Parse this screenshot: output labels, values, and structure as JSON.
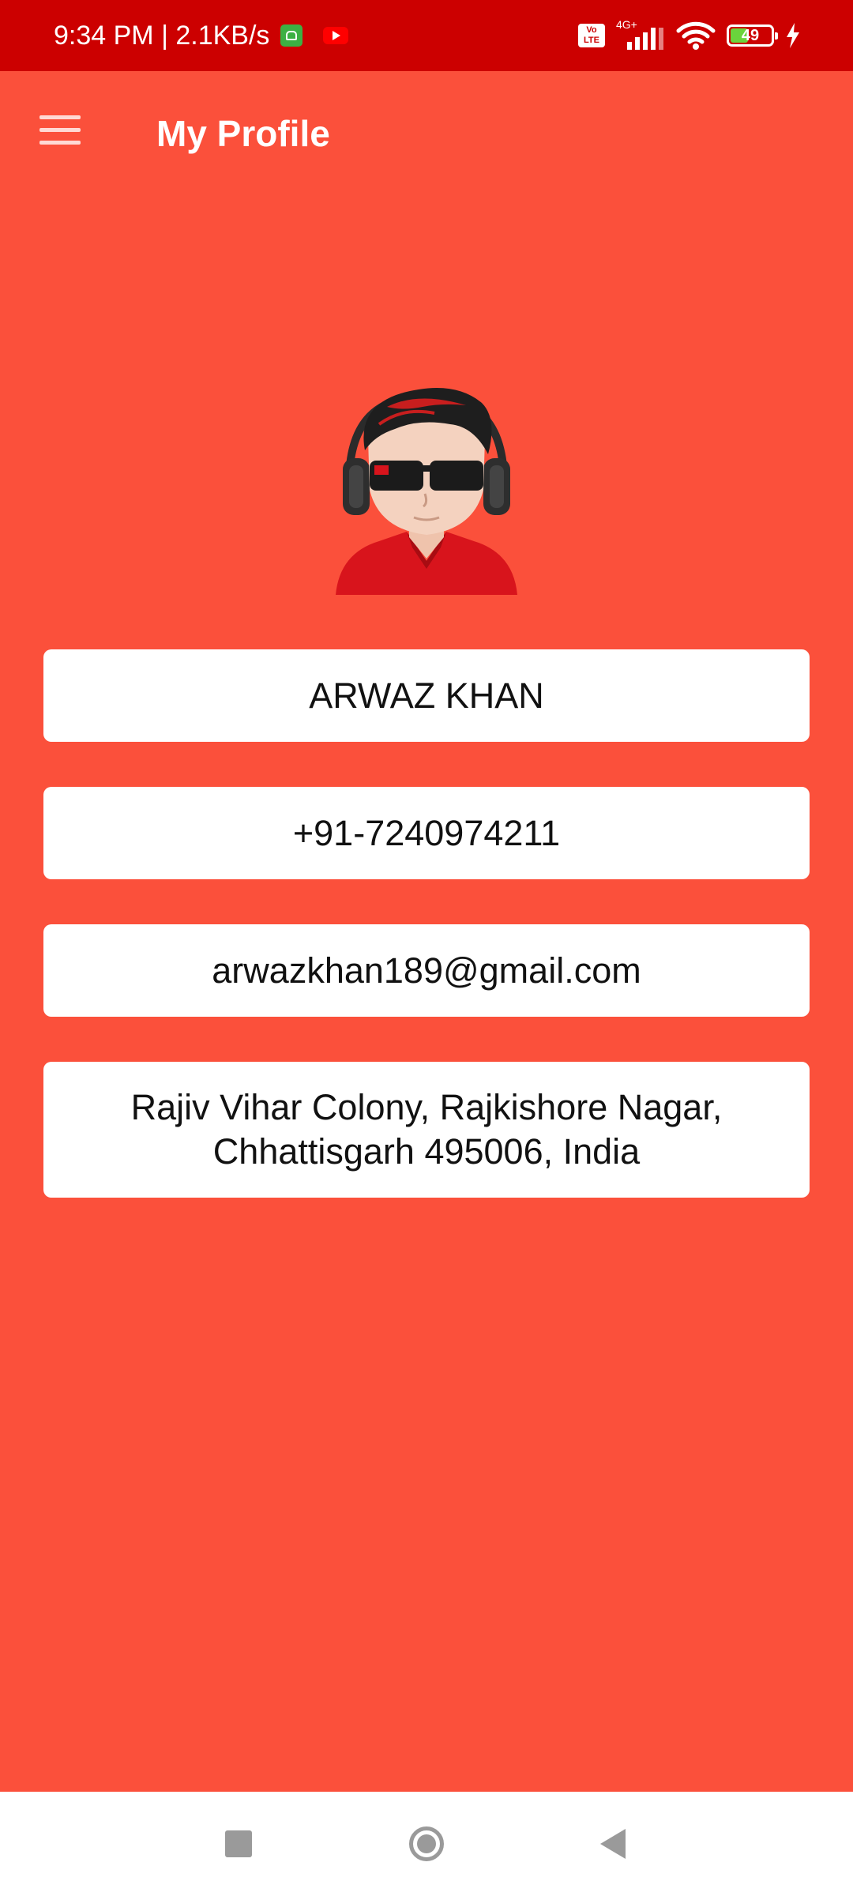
{
  "status_bar": {
    "time_speed": "9:34 PM | 2.1KB/s",
    "volte_line1": "Vo",
    "volte_line2": "LTE",
    "network_type": "4G+",
    "battery_level": "49",
    "battery_percent": 49,
    "icons": [
      "android-app-icon",
      "youtube-icon",
      "volte-icon",
      "signal-icon",
      "wifi-icon",
      "battery-icon",
      "charging-bolt-icon"
    ]
  },
  "app_bar": {
    "title": "My Profile",
    "menu_icon": "hamburger-menu-icon"
  },
  "profile": {
    "avatar_icon": "cartoon-avatar-with-headphones",
    "name": "ARWAZ KHAN",
    "phone": "+91-7240974211",
    "email": "arwazkhan189@gmail.com",
    "address": "Rajiv Vihar Colony, Rajkishore Nagar, Chhattisgarh 495006, India"
  },
  "nav_bar": {
    "icons": [
      "recents-square-icon",
      "home-circle-icon",
      "back-triangle-icon"
    ]
  },
  "colors": {
    "status_bar": "#cc0000",
    "background": "#fb503b",
    "card": "#ffffff",
    "nav_bar": "#ffffff"
  }
}
